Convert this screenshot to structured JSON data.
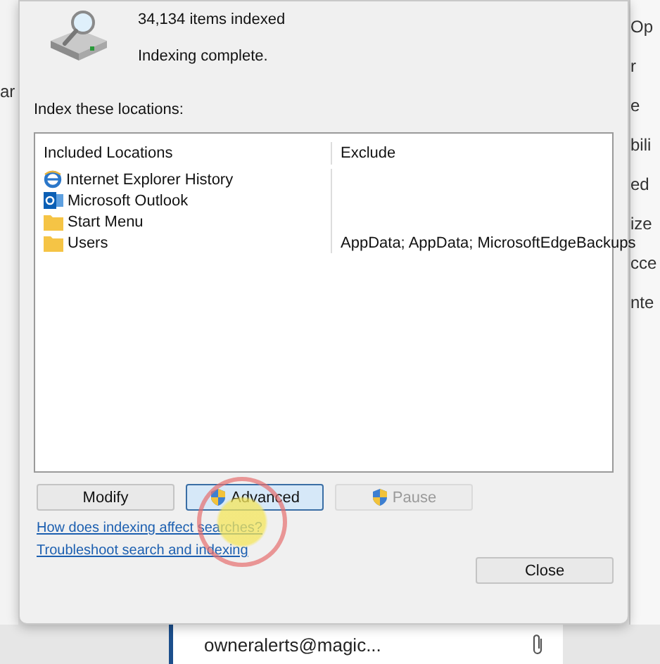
{
  "background": {
    "left_fragment": "ar",
    "right_fragments": [
      "Op",
      "r",
      "e",
      "bili",
      "ed",
      "ize",
      "cce",
      "nte"
    ],
    "email_sender": "owneralerts@magic..."
  },
  "dialog": {
    "items_indexed": "34,134 items indexed",
    "status": "Indexing complete.",
    "locations_label": "Index these locations:",
    "table": {
      "columns": [
        "Included Locations",
        "Exclude"
      ],
      "rows": [
        {
          "kind": "browser",
          "location": "Internet Explorer History",
          "exclude": ""
        },
        {
          "kind": "mail",
          "location": "Microsoft Outlook",
          "exclude": ""
        },
        {
          "kind": "folder",
          "location": "Start Menu",
          "exclude": ""
        },
        {
          "kind": "folder",
          "location": "Users",
          "exclude": "AppData; AppData; MicrosoftEdgeBackups"
        }
      ]
    },
    "buttons": [
      {
        "label": "Modify",
        "shield": false,
        "hovered": false,
        "disabled": false
      },
      {
        "label": "Advanced",
        "shield": true,
        "hovered": true,
        "disabled": false
      },
      {
        "label": "Pause",
        "shield": true,
        "hovered": false,
        "disabled": true
      }
    ],
    "links": [
      "How does indexing affect searches?",
      "Troubleshoot search and indexing"
    ],
    "close_button": "Close"
  }
}
